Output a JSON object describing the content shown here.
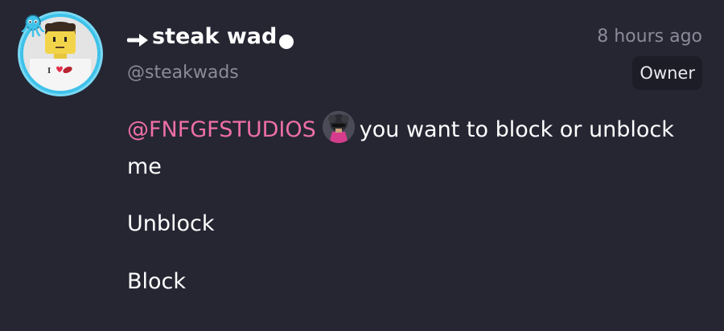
{
  "post": {
    "author": {
      "display_name": "steak wad",
      "handle": "@steakwads",
      "avatar_text": "I",
      "avatar_colors": {
        "ring": "#3fc2ea",
        "skin": "#f2d44a",
        "hair": "#3b2a1e",
        "shirt": "#f5f5f5",
        "heart": "#e2304a"
      }
    },
    "timestamp": "8 hours ago",
    "role": "Owner",
    "mention": "@FNFGFSTUDIOS",
    "message_text": "you want to block or unblock me",
    "reply_lines": [
      "Unblock",
      "Block"
    ]
  },
  "icons": {
    "name_prefix": "right-arrow-icon",
    "name_suffix": "half-moon-circle-icon",
    "avatar_badge": "octopus-badge-icon",
    "mention_avatar": "user-avatar-icon"
  },
  "colors": {
    "background": "#262633",
    "mention": "#ee6fa5",
    "muted_text": "#8a8a99",
    "badge_bg": "#1d1d27"
  }
}
